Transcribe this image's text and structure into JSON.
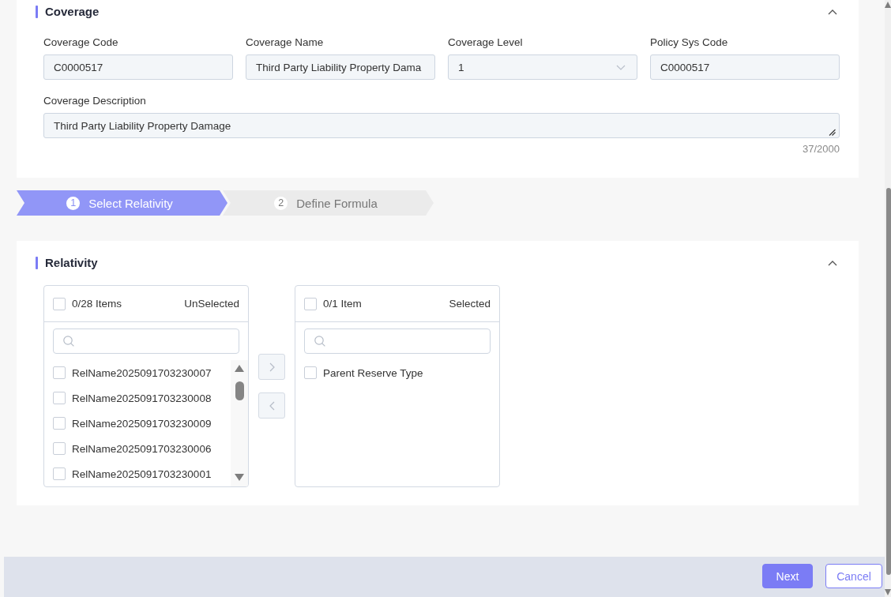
{
  "coverage_section": {
    "title": "Coverage",
    "expanded": true,
    "fields": [
      {
        "label": "Coverage Code",
        "value": "C0000517",
        "kind": "text"
      },
      {
        "label": "Coverage Name",
        "value": "Third Party Liability Property Dama",
        "kind": "text"
      },
      {
        "label": "Coverage Level",
        "value": "1",
        "kind": "select"
      },
      {
        "label": "Policy Sys Code",
        "value": "C0000517",
        "kind": "text"
      },
      {
        "label": "Coverage Description",
        "value": "Third Party Liability Property Damage",
        "kind": "textarea",
        "counter": "37/2000"
      }
    ]
  },
  "steps": [
    {
      "number": "1",
      "label": "Select Relativity",
      "selected": true
    },
    {
      "number": "2",
      "label": "Define Formula",
      "selected": false
    }
  ],
  "relativity_section": {
    "title": "Relativity",
    "expanded": true,
    "transfer": {
      "source": {
        "checked": false,
        "count": "0/28 Items",
        "title": "UnSelected",
        "items": [
          {
            "label": "RelName2025091703230007",
            "checked": false
          },
          {
            "label": "RelName2025091703230008",
            "checked": false
          },
          {
            "label": "RelName2025091703230009",
            "checked": false
          },
          {
            "label": "RelName2025091703230006",
            "checked": false
          },
          {
            "label": "RelName2025091703230001",
            "checked": false
          }
        ]
      },
      "move_buttons": [
        {
          "kind": "right",
          "disabled": true
        },
        {
          "kind": "left",
          "disabled": true
        }
      ],
      "target": {
        "checked": false,
        "count": "0/1 Item",
        "title": "Selected",
        "items": [
          {
            "label": "Parent Reserve Type",
            "checked": false
          }
        ]
      }
    }
  },
  "footer": {
    "buttons": [
      {
        "label": "Next",
        "kind": "primary"
      },
      {
        "label": "Cancel",
        "kind": "secondary"
      }
    ]
  }
}
